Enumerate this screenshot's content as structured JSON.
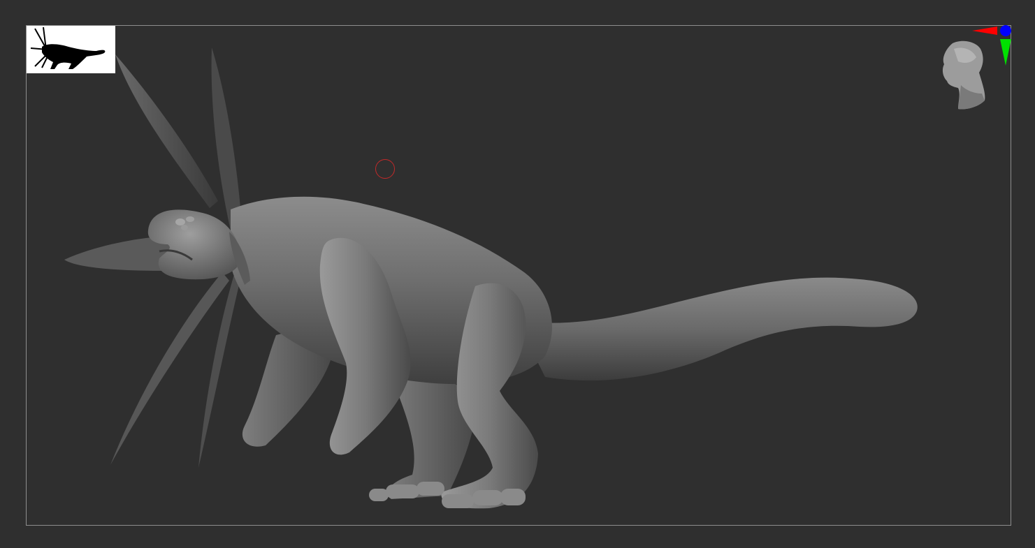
{
  "app": {
    "name": "",
    "view": "sculpt-viewport"
  },
  "colors": {
    "background": "#2f2f2f",
    "frame": "#8e8e8e",
    "axis_x": "#ff0000",
    "axis_y": "#00ff00",
    "axis_z": "#0000ff",
    "brush_cursor": "#c22a2a",
    "thumbnail_bg": "#ffffff"
  },
  "icons": {
    "thumbnail": "creature-silhouette-icon",
    "navigation": "head-orientation-icon",
    "axes": "axis-gizmo-icon",
    "cursor": "brush-cursor-icon"
  }
}
